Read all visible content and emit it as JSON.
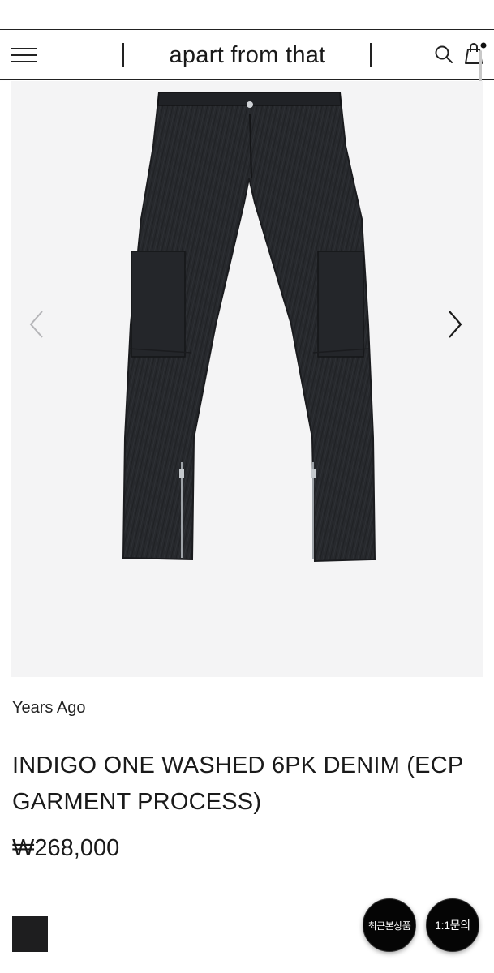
{
  "header": {
    "logo_text": "apart from that",
    "menu_icon": "hamburger-menu-icon",
    "search_icon": "search-icon",
    "cart_icon": "shopping-bag-icon"
  },
  "gallery": {
    "image_alt": "INDIGO ONE WASHED 6PK DENIM (ECP GARMENT PROCESS)",
    "prev_icon": "chevron-left-icon",
    "next_icon": "chevron-right-icon",
    "background": "#f4f4f5"
  },
  "product": {
    "brand": "Years Ago",
    "title": "INDIGO ONE WASHED 6PK DENIM (ECP GARMENT PROCESS)",
    "price": "₩268,000",
    "color_swatch": "#1e1e1f"
  },
  "floating": {
    "recent_label": "최근본상품",
    "inquiry_label": "1:1문의"
  }
}
